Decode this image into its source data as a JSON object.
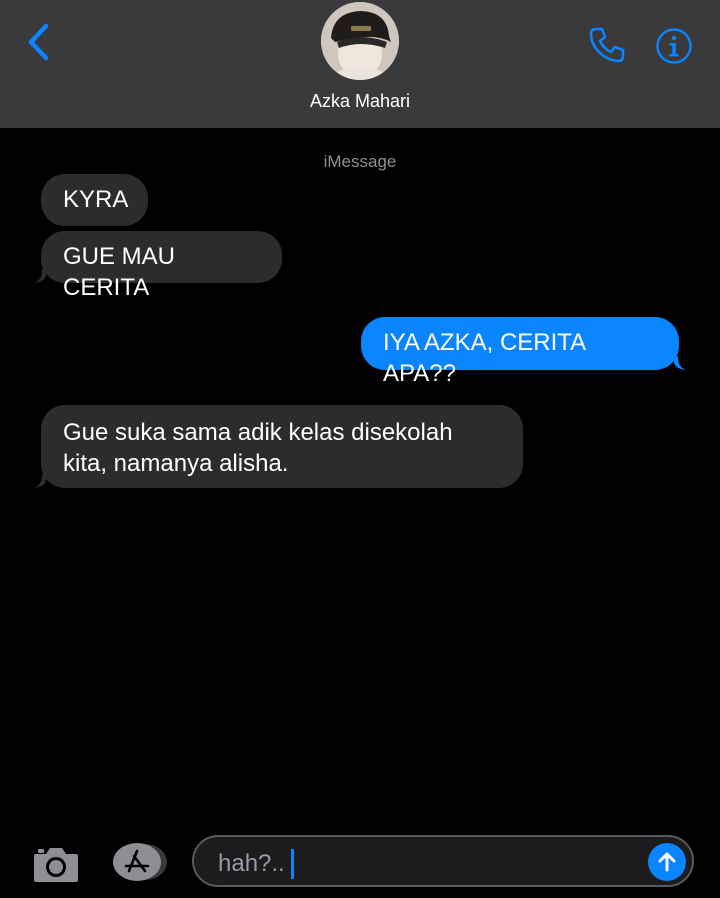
{
  "header": {
    "contact_name": "Azka Mahari"
  },
  "thread": {
    "service_label": "iMessage",
    "messages": [
      {
        "direction": "incoming",
        "text": "KYRA"
      },
      {
        "direction": "incoming",
        "text": "GUE MAU CERITA"
      },
      {
        "direction": "outgoing",
        "text": "IYA AZKA, CERITA APA??"
      },
      {
        "direction": "incoming",
        "text": "Gue suka sama adik kelas disekolah kita, namanya alisha."
      }
    ]
  },
  "composer": {
    "value": "hah?.."
  },
  "icons": {
    "back": "chevron-left-icon",
    "call": "phone-icon",
    "info": "info-icon",
    "camera": "camera-icon",
    "apps": "app-store-icon",
    "send": "arrow-up-icon"
  },
  "colors": {
    "accent": "#0a84ff",
    "header_bg": "#3a3a3c",
    "incoming_bubble": "#2c2c2e",
    "background": "#000000"
  }
}
